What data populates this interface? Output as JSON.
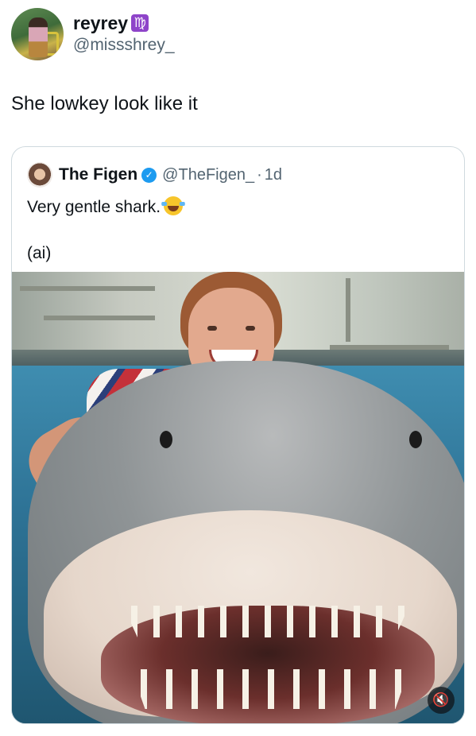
{
  "post": {
    "display_name": "reyrey",
    "badge": "♍",
    "handle": "@missshrey_",
    "text": "She lowkey look like it"
  },
  "quoted": {
    "display_name": "The Figen",
    "verified_icon": "verified-badge-icon",
    "handle": "@TheFigen_",
    "separator": "·",
    "time": "1d",
    "text": "Very gentle shark.",
    "emoji": "laughing-tears-emoji",
    "subtext": "(ai)"
  },
  "media": {
    "mute_icon": "🔇"
  },
  "colors": {
    "text": "#0f1419",
    "secondary": "#536471",
    "border": "#cfd9de",
    "verified": "#1d9bf0"
  }
}
